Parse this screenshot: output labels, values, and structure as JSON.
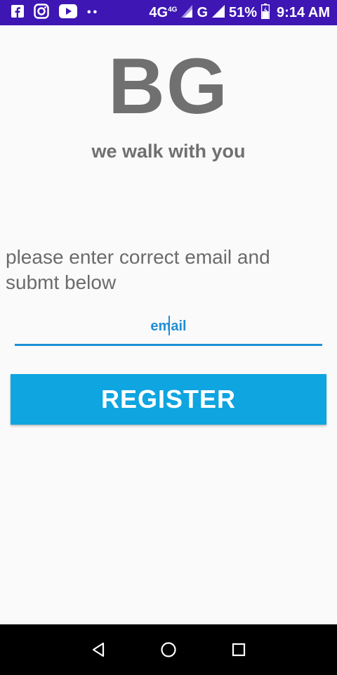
{
  "status_bar": {
    "icons": [
      "facebook-icon",
      "instagram-icon",
      "youtube-icon",
      "more-dots-icon"
    ],
    "network_text": "4G",
    "network_small": "4G",
    "network_g": "G",
    "battery_percent": "51%",
    "time": "9:14 AM"
  },
  "app": {
    "logo_text": "BG",
    "tagline": "we walk with you",
    "instructions": "please enter correct email and submt below",
    "email_placeholder": "email",
    "register_label": "REGISTER"
  },
  "nav_bar": {
    "icons": [
      "back-icon",
      "home-icon",
      "recents-icon"
    ]
  },
  "colors": {
    "status_bar": "#3d16b4",
    "accent": "#1f8fd6",
    "button": "#0ea5e0",
    "text_gray": "#707070"
  }
}
